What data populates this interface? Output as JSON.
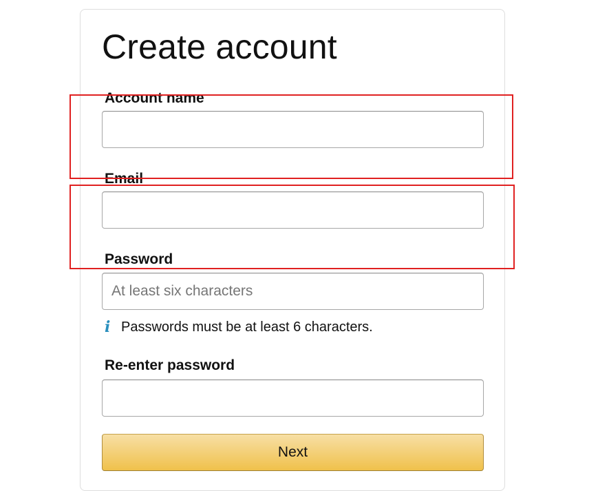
{
  "form": {
    "title": "Create account",
    "account_name": {
      "label": "Account name",
      "value": "",
      "placeholder": ""
    },
    "email": {
      "label": "Email",
      "value": "",
      "placeholder": ""
    },
    "password": {
      "label": "Password",
      "value": "",
      "placeholder": "At least six characters"
    },
    "password_hint": {
      "icon": "info-icon",
      "text": "Passwords must be at least 6 characters."
    },
    "reenter_password": {
      "label": "Re-enter password",
      "value": "",
      "placeholder": ""
    },
    "next_label": "Next"
  },
  "colors": {
    "highlight": "#e02020",
    "button_gradient_top": "#f7dfa5",
    "button_gradient_bottom": "#f0c14b",
    "info_icon": "#2a8fbd"
  }
}
